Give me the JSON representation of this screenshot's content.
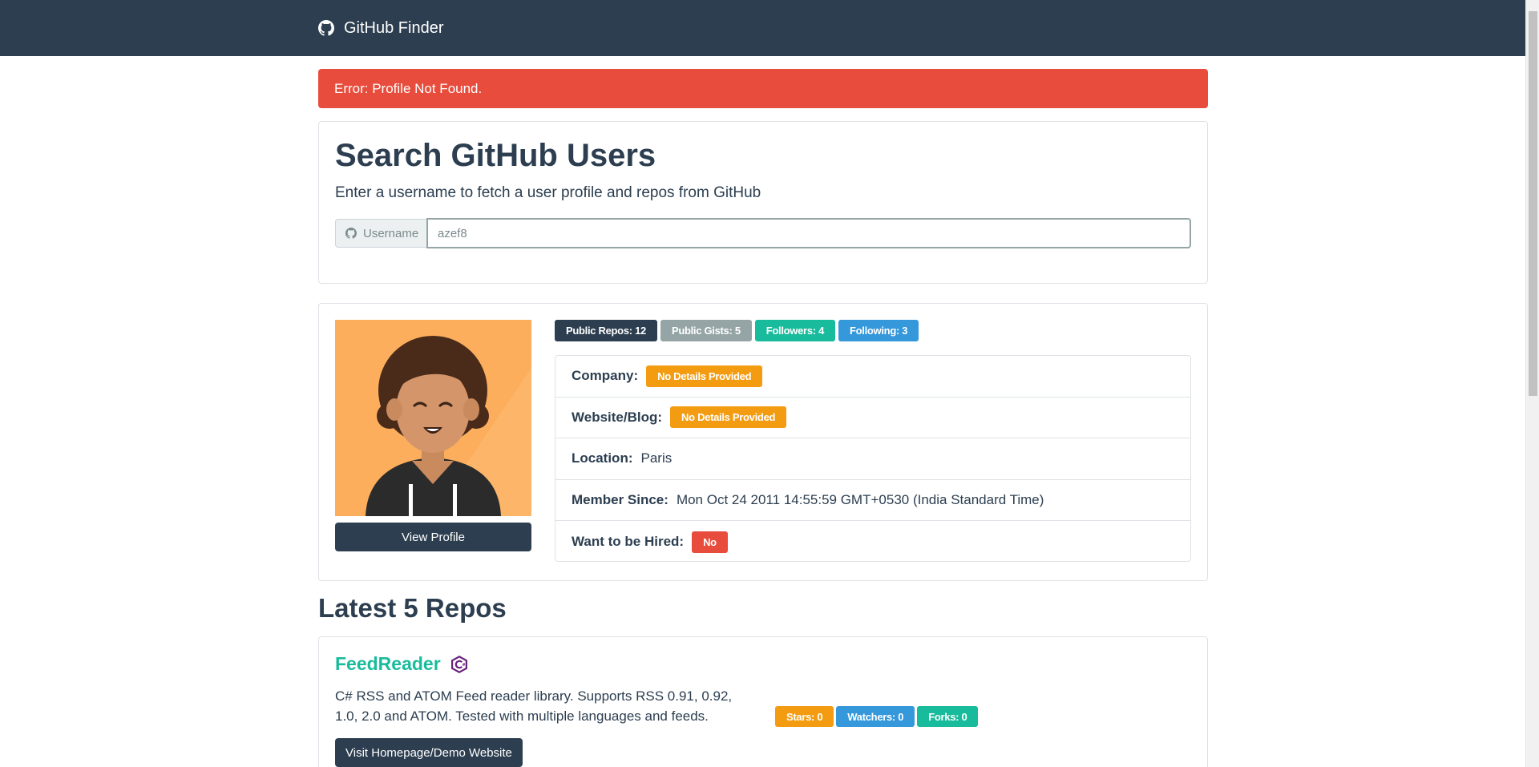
{
  "navbar": {
    "brand": "GitHub Finder"
  },
  "alert": {
    "message": "Error: Profile Not Found."
  },
  "search": {
    "title": "Search GitHub Users",
    "subtitle": "Enter a username to fetch a user profile and repos from GitHub",
    "prepend_label": "Username",
    "value": "azef8"
  },
  "profile": {
    "view_button": "View Profile",
    "badges": [
      {
        "label": "Public Repos: 12",
        "color": "#2c3e50"
      },
      {
        "label": "Public Gists: 5",
        "color": "#95a5a6"
      },
      {
        "label": "Followers: 4",
        "color": "#18bc9c"
      },
      {
        "label": "Following: 3",
        "color": "#3498db"
      }
    ],
    "details": {
      "company": {
        "label": "Company:",
        "value": "No Details Provided"
      },
      "website": {
        "label": "Website/Blog:",
        "value": "No Details Provided"
      },
      "location": {
        "label": "Location:",
        "value": "Paris"
      },
      "member_since": {
        "label": "Member Since:",
        "value": "Mon Oct 24 2011 14:55:59 GMT+0530 (India Standard Time)"
      },
      "hireable": {
        "label": "Want to be Hired:",
        "value": "No"
      }
    }
  },
  "repos": {
    "title": "Latest 5 Repos",
    "items": [
      {
        "name": "FeedReader",
        "description": "C# RSS and ATOM Feed reader library. Supports RSS 0.91, 0.92, 1.0, 2.0 and ATOM. Tested with multiple languages and feeds.",
        "stars": "Stars: 0",
        "watchers": "Watchers: 0",
        "forks": "Forks: 0",
        "button": "Visit Homepage/Demo Website"
      }
    ]
  },
  "colors": {
    "primary": "#2c3e50",
    "danger": "#e74c3c",
    "success": "#18bc9c",
    "info": "#3498db",
    "warning": "#f39c12",
    "secondary": "#95a5a6"
  }
}
